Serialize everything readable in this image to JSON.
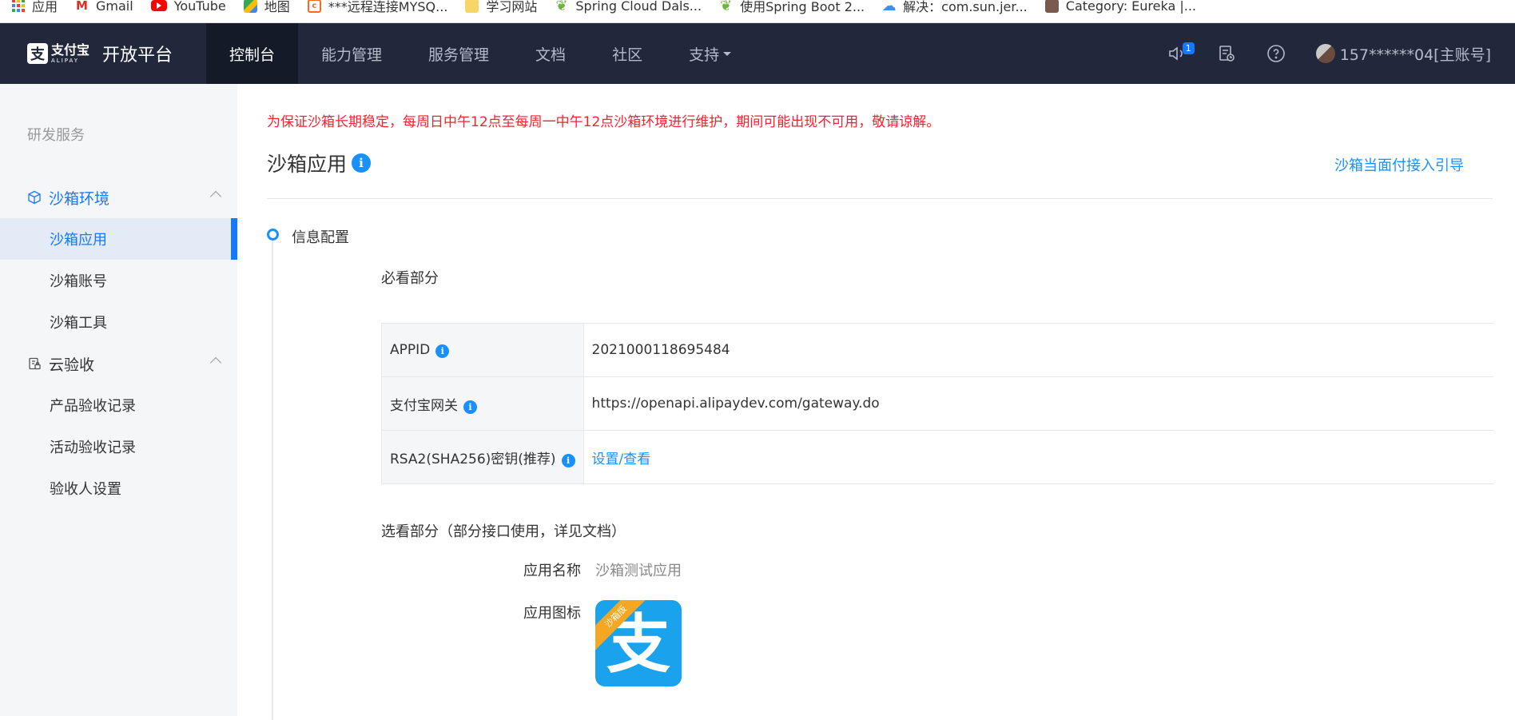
{
  "bookmarks": [
    {
      "label": "应用",
      "icon": "apps-grid-icon"
    },
    {
      "label": "Gmail",
      "icon": "gmail-icon"
    },
    {
      "label": "YouTube",
      "icon": "youtube-icon"
    },
    {
      "label": "地图",
      "icon": "maps-icon"
    },
    {
      "label": "***远程连接MYSQ...",
      "icon": "remote-icon"
    },
    {
      "label": "学习网站",
      "icon": "folder-icon"
    },
    {
      "label": "Spring Cloud Dals...",
      "icon": "spring-icon"
    },
    {
      "label": "使用Spring Boot 2...",
      "icon": "spring-icon"
    },
    {
      "label": "解决：com.sun.jer...",
      "icon": "cloud-icon"
    },
    {
      "label": "Category: Eureka |...",
      "icon": "avatar-icon"
    }
  ],
  "header": {
    "logo_cn": "支付宝",
    "logo_en": "ALIPAY",
    "platform_title": "开放平台",
    "nav": [
      "控制台",
      "能力管理",
      "服务管理",
      "文档",
      "社区",
      "支持"
    ],
    "notification_count": "1",
    "user": "157******04[主账号]"
  },
  "sidebar": {
    "group_title": "研发服务",
    "sandbox_section": "沙箱环境",
    "sandbox_items": [
      "沙箱应用",
      "沙箱账号",
      "沙箱工具"
    ],
    "cloud_section": "云验收",
    "cloud_items": [
      "产品验收记录",
      "活动验收记录",
      "验收人设置"
    ]
  },
  "main": {
    "notice": "为保证沙箱长期稳定，每周日中午12点至每周一中午12点沙箱环境进行维护，期间可能出现不可用，敬请谅解。",
    "title": "沙箱应用",
    "guide_link": "沙箱当面付接入引导",
    "step_title": "信息配置",
    "required_title": "必看部分",
    "config": {
      "appid_label": "APPID",
      "appid_value": "2021000118695484",
      "gateway_label": "支付宝网关",
      "gateway_value": "https://openapi.alipaydev.com/gateway.do",
      "rsa_label": "RSA2(SHA256)密钥(推荐)",
      "rsa_value": "设置/查看"
    },
    "optional_title": "选看部分（部分接口使用，详见文档）",
    "app_name_label": "应用名称",
    "app_name_value": "沙箱测试应用",
    "app_icon_label": "应用图标",
    "app_icon_char": "支",
    "app_icon_ribbon": "沙箱版"
  },
  "colors": {
    "accent": "#1677ff",
    "nav_bg": "#22283b",
    "notice": "#f5222d",
    "sidebar_bg": "#f5f6f8"
  }
}
